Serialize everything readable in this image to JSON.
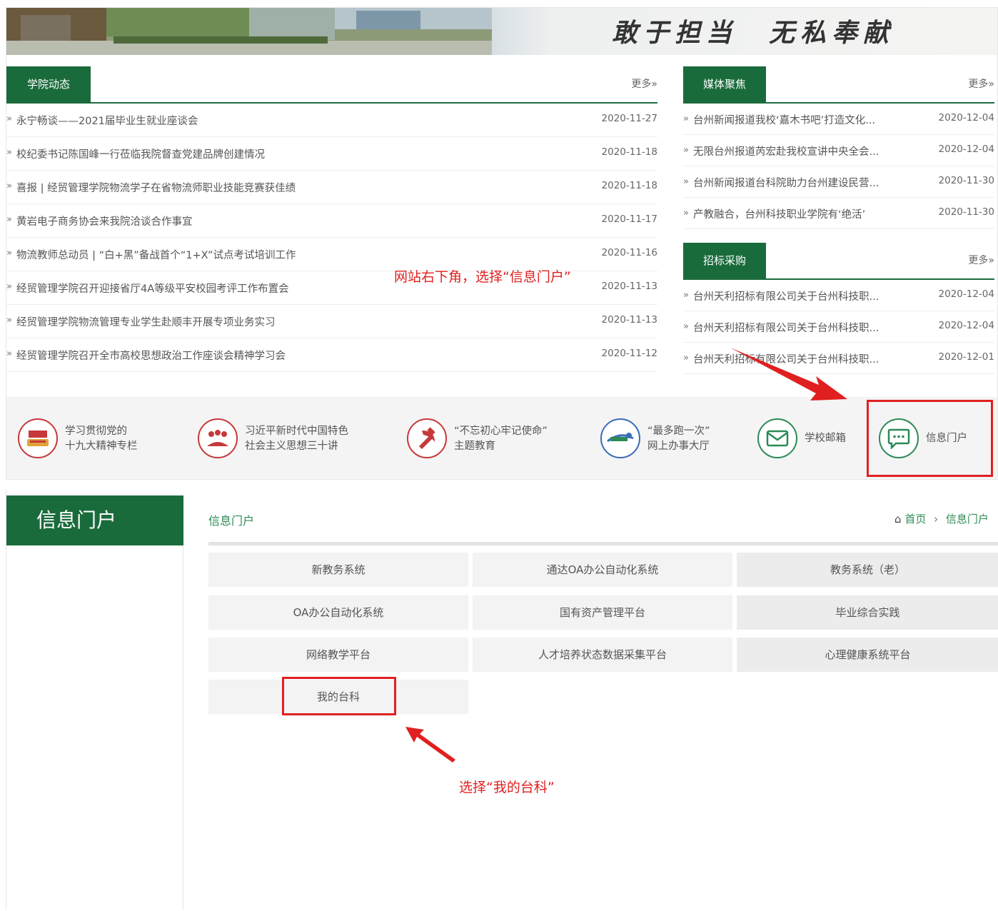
{
  "top": {
    "slogan": "敢于担当　无私奉献",
    "news": {
      "tab_label": "学院动态",
      "more_label": "更多»",
      "items": [
        {
          "title": "永宁畅谈——2021届毕业生就业座谈会",
          "date": "2020-11-27"
        },
        {
          "title": "校纪委书记陈国峰一行莅临我院督查党建品牌创建情况",
          "date": "2020-11-18"
        },
        {
          "title": "喜报 | 经贸管理学院物流学子在省物流师职业技能竞赛获佳绩",
          "date": "2020-11-18"
        },
        {
          "title": "黄岩电子商务协会来我院洽谈合作事宜",
          "date": "2020-11-17"
        },
        {
          "title": "物流教师总动员 | “白+黑”备战首个“1+X”试点考试培训工作",
          "date": "2020-11-16"
        },
        {
          "title": "经贸管理学院召开迎接省厅4A等级平安校园考评工作布置会",
          "date": "2020-11-13"
        },
        {
          "title": "经贸管理学院物流管理专业学生赴顺丰开展专项业务实习",
          "date": "2020-11-13"
        },
        {
          "title": "经贸管理学院召开全市高校思想政治工作座谈会精神学习会",
          "date": "2020-11-12"
        }
      ]
    },
    "media": {
      "tab_label": "媒体聚焦",
      "more_label": "更多»",
      "items": [
        {
          "title": "台州新闻报道我校‘嘉木书吧’打造文化...",
          "date": "2020-12-04"
        },
        {
          "title": "无限台州报道芮宏赴我校宣讲中央全会...",
          "date": "2020-12-04"
        },
        {
          "title": "台州新闻报道台科院助力台州建设民营...",
          "date": "2020-11-30"
        },
        {
          "title": "产教融合，台州科技职业学院有‘绝活’",
          "date": "2020-11-30"
        }
      ]
    },
    "bidding": {
      "tab_label": "招标采购",
      "more_label": "更多»",
      "items": [
        {
          "title": "台州天利招标有限公司关于台州科技职...",
          "date": "2020-12-04"
        },
        {
          "title": "台州天利招标有限公司关于台州科技职...",
          "date": "2020-12-04"
        },
        {
          "title": "台州天利招标有限公司关于台州科技职...",
          "date": "2020-12-01"
        }
      ]
    },
    "quick_links": [
      {
        "line1": "学习贯彻党的",
        "line2": "十九大精神专栏",
        "icon": "flag-book-icon"
      },
      {
        "line1": "习近平新时代中国特色",
        "line2": "社会主义思想三十讲",
        "icon": "people-book-icon"
      },
      {
        "line1": "“不忘初心牢记使命”",
        "line2": "主题教育",
        "icon": "hammer-sickle-icon"
      },
      {
        "line1": "“最多跑一次”",
        "line2": "网上办事大厅",
        "icon": "service-logo-icon"
      },
      {
        "line1": "学校邮箱",
        "line2": "",
        "icon": "mail-icon"
      },
      {
        "line1": "信息门户",
        "line2": "",
        "icon": "chat-bubble-icon"
      }
    ],
    "annotation": "网站右下角，选择“信息门户”",
    "annotation_color": "#e02020"
  },
  "bottom": {
    "side_title": "信息门户",
    "portal_heading": "信息门户",
    "breadcrumb": {
      "home": "首页",
      "separator": "›",
      "current": "信息门户"
    },
    "systems": [
      "新教务系统",
      "通达OA办公自动化系统",
      "教务系统（老）",
      "OA办公自动化系统",
      "国有资产管理平台",
      "毕业综合实践",
      "网络教学平台",
      "人才培养状态数据采集平台",
      "心理健康系统平台",
      "我的台科"
    ],
    "annotation": "选择“我的台科”"
  },
  "colors": {
    "brand_green": "#1a6b3c",
    "annotation_red": "#e02020"
  }
}
